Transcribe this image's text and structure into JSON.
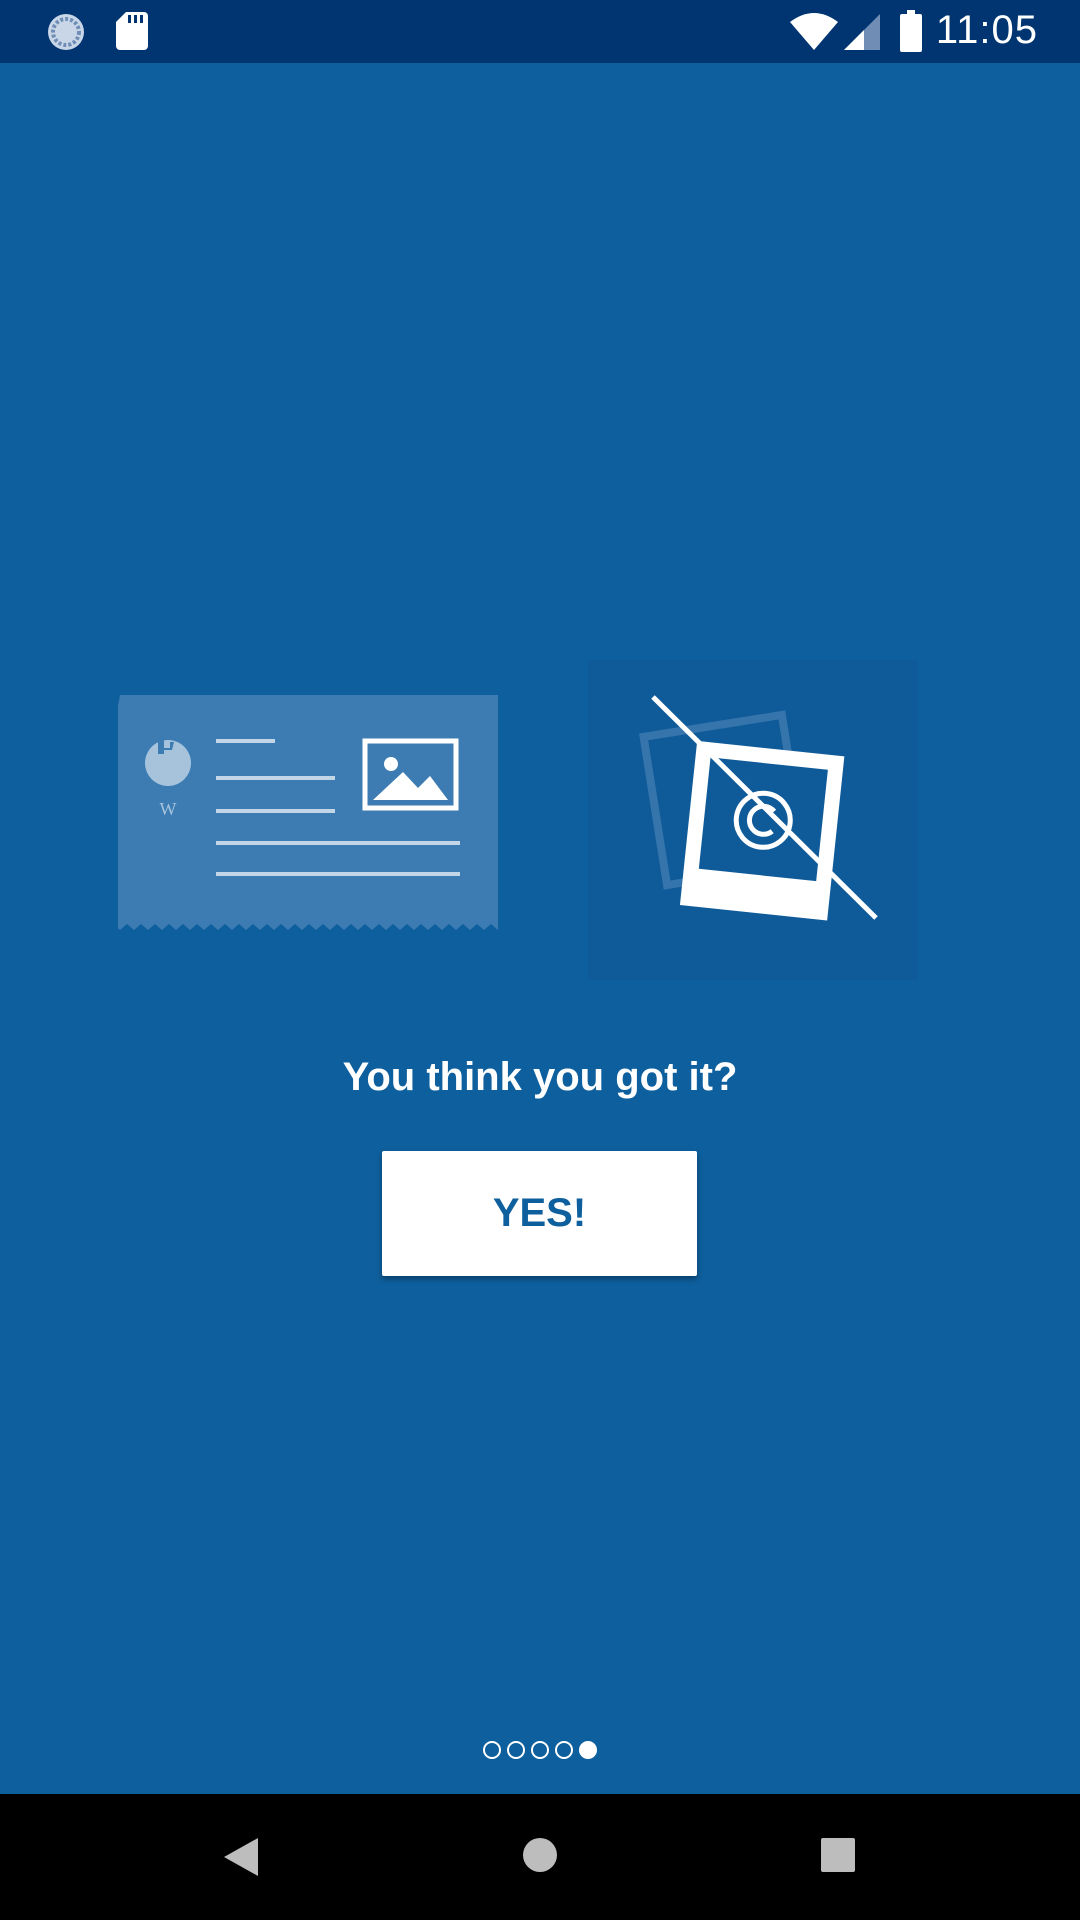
{
  "status_bar": {
    "time": "11:05",
    "left_icons": [
      "sync-circle-icon",
      "sd-card-icon"
    ],
    "right_icons": [
      "wifi-icon",
      "signal-icon",
      "battery-icon"
    ]
  },
  "illustration": {
    "card_logo_letter": "W",
    "icons": [
      "wikipedia-card-icon",
      "no-copyrighted-photo-icon"
    ]
  },
  "onboarding": {
    "title": "You think you got it?",
    "confirm_label": "YES!"
  },
  "pager": {
    "total": 5,
    "current": 5
  },
  "nav_bar": {
    "buttons": [
      "back-icon",
      "home-icon",
      "recents-icon"
    ]
  },
  "colors": {
    "background": "#0e5f9d",
    "status_bar": "#013571",
    "button_text": "#0e5f9d"
  }
}
